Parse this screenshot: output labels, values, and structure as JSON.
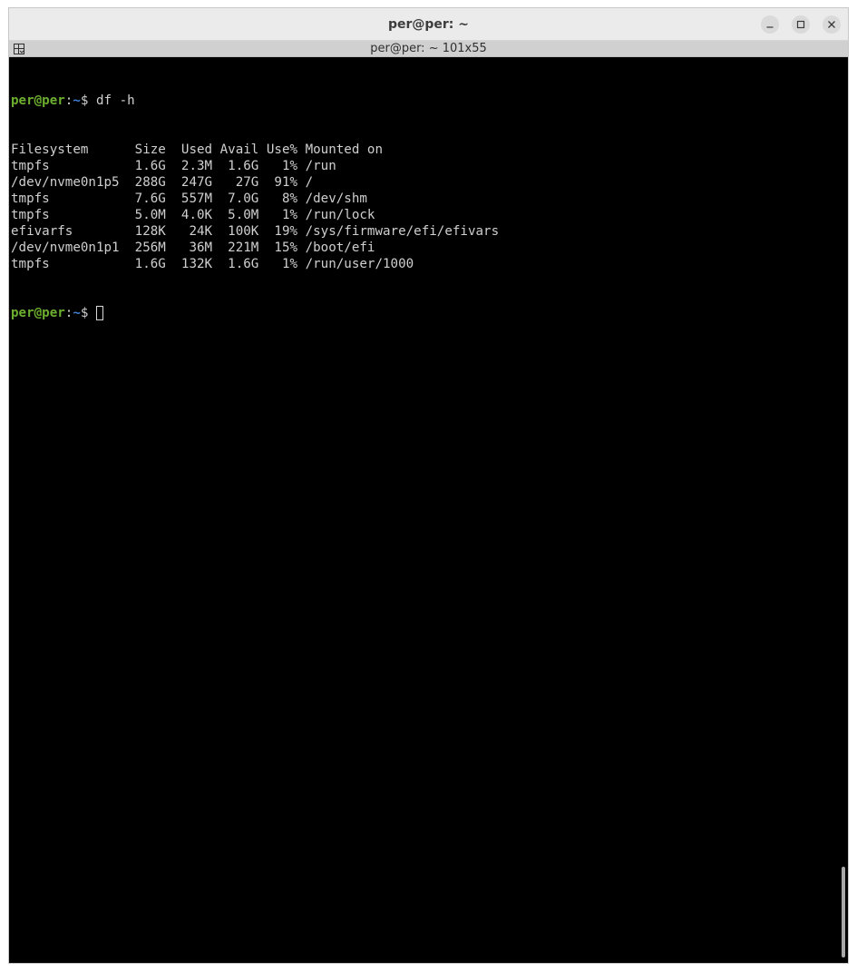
{
  "window": {
    "title": "per@per: ~",
    "controls": {
      "minimize_icon": "minimize-icon",
      "maximize_icon": "maximize-icon",
      "close_icon": "close-icon"
    }
  },
  "tab": {
    "title": "per@per: ~ 101x55",
    "icon": "tab-menu-icon"
  },
  "prompt": {
    "user_host": "per@per",
    "colon": ":",
    "path": "~",
    "sign": "$"
  },
  "terminal": {
    "command": " df -h",
    "output_lines": [
      "Filesystem      Size  Used Avail Use% Mounted on",
      "tmpfs           1.6G  2.3M  1.6G   1% /run",
      "/dev/nvme0n1p5  288G  247G   27G  91% /",
      "tmpfs           7.6G  557M  7.0G   8% /dev/shm",
      "tmpfs           5.0M  4.0K  5.0M   1% /run/lock",
      "efivarfs        128K   24K  100K  19% /sys/firmware/efi/efivars",
      "/dev/nvme0n1p1  256M   36M  221M  15% /boot/efi",
      "tmpfs           1.6G  132K  1.6G   1% /run/user/1000"
    ]
  },
  "colors": {
    "terminal_bg": "#000000",
    "terminal_fg": "#cfcfcf",
    "prompt_user": "#6cae2f",
    "prompt_path": "#3e7fd5",
    "titlebar_bg": "#ebebeb"
  }
}
